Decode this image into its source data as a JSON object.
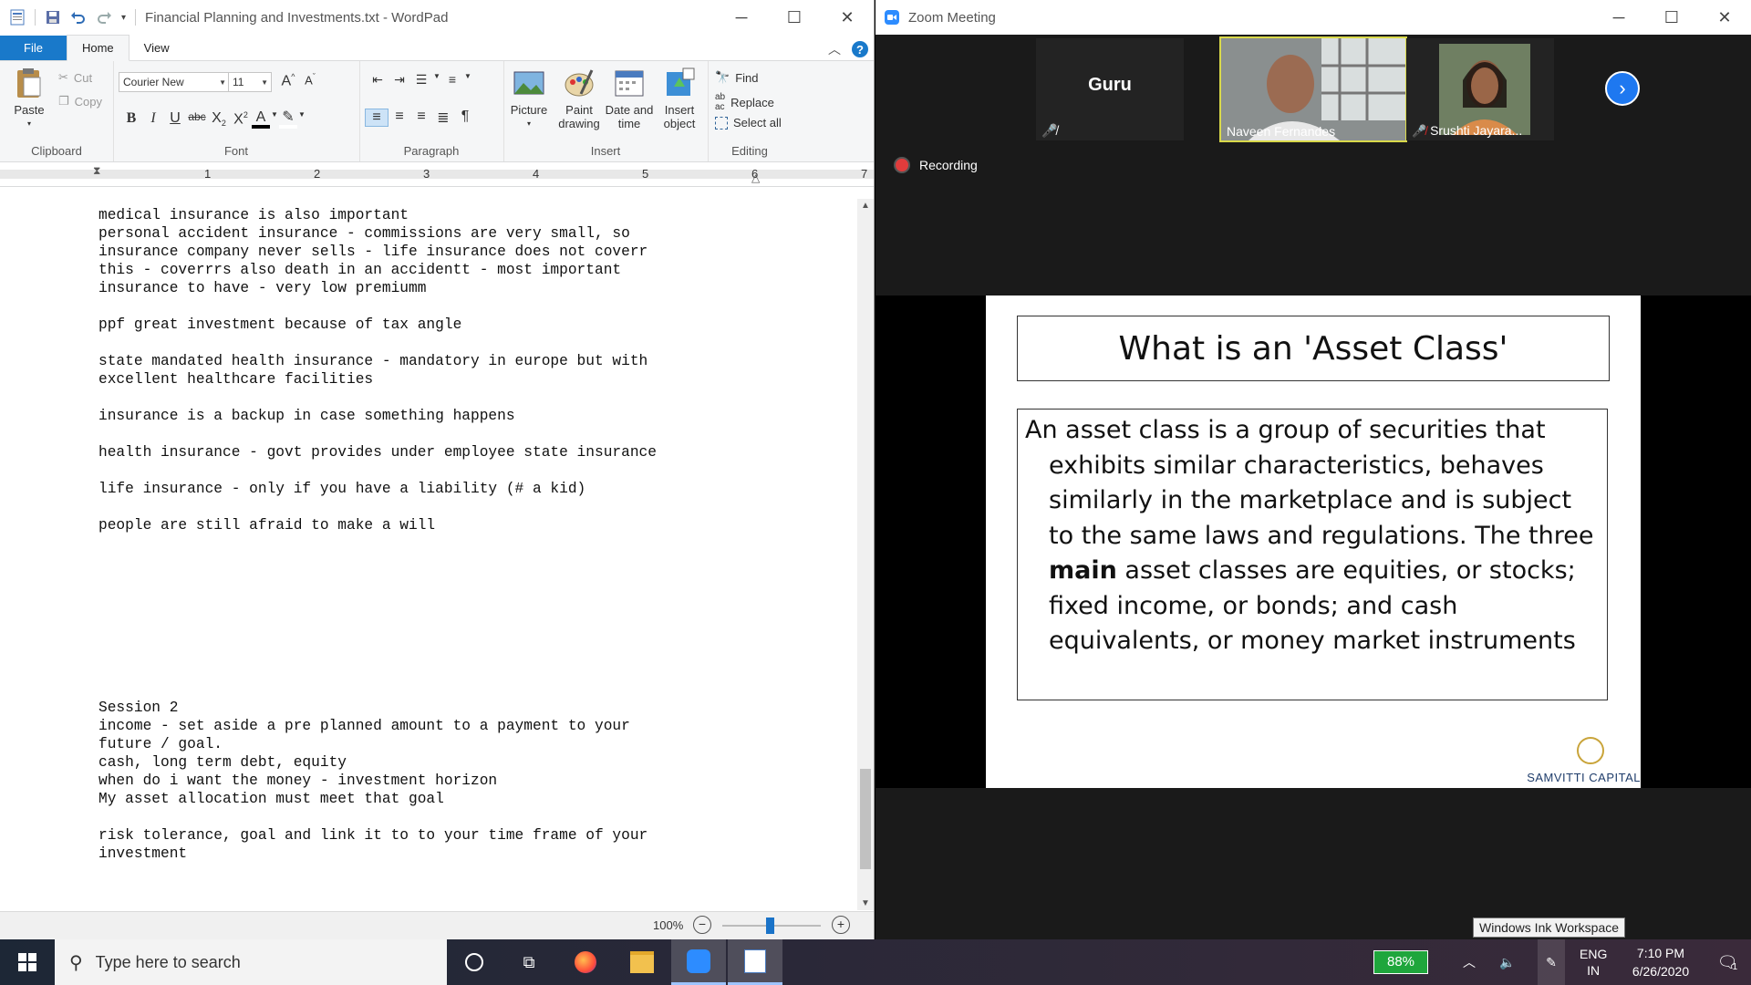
{
  "wordpad": {
    "title": "Financial Planning and Investments.txt - WordPad",
    "tabs": {
      "file": "File",
      "home": "Home",
      "view": "View"
    },
    "clipboard": {
      "paste": "Paste",
      "cut": "Cut",
      "copy": "Copy",
      "label": "Clipboard"
    },
    "font": {
      "family": "Courier New",
      "size": "11",
      "label": "Font"
    },
    "paragraph": {
      "label": "Paragraph"
    },
    "insert": {
      "picture": "Picture",
      "paint_line1": "Paint",
      "paint_line2": "drawing",
      "date_line1": "Date and",
      "date_line2": "time",
      "object_line1": "Insert",
      "object_line2": "object",
      "label": "Insert"
    },
    "editing": {
      "find": "Find",
      "replace": "Replace",
      "select_all": "Select all",
      "label": "Editing"
    },
    "ruler_numbers": [
      "1",
      "2",
      "3",
      "4",
      "5",
      "6",
      "7"
    ],
    "document_text": "medical insurance is also important\npersonal accident insurance - commissions are very small, so\ninsurance company never sells - life insurance does not coverr\nthis - coverrrs also death in an accidentt - most important\ninsurance to have - very low premiumm\n\nppf great investment because of tax angle\n\nstate mandated health insurance - mandatory in europe but with\nexcellent healthcare facilities\n\ninsurance is a backup in case something happens\n\nhealth insurance - govt provides under employee state insurance\n\nlife insurance - only if you have a liability (# a kid)\n\npeople are still afraid to make a will\n\n\n\n\n\n\n\n\n\nSession 2\nincome - set aside a pre planned amount to a payment to your\nfuture / goal.\ncash, long term debt, equity\nwhen do i want the money - investment horizon\nMy asset allocation must meet that goal\n\nrisk tolerance, goal and link it to to your time frame of your\ninvestment",
    "zoom_level": "100%"
  },
  "zoom": {
    "title": "Zoom Meeting",
    "participants": [
      {
        "name": "Guru",
        "muted": true
      },
      {
        "name": "Naveen Fernandes",
        "muted": false
      },
      {
        "name": "Srushti Jayara...",
        "muted": true
      }
    ],
    "recording_label": "Recording",
    "slide": {
      "title": "What is an 'Asset Class'",
      "body_before": "An asset class is a group of securities that exhibits similar characteristics, behaves similarly in the marketplace and is subject to the same laws and regulations. The three ",
      "body_bold": "main",
      "body_after": " asset classes are equities, or stocks; fixed income, or bonds; and cash equivalents, or money market instruments",
      "brand": "SAMVITTI CAPITAL"
    }
  },
  "tooltip": "Windows Ink Workspace",
  "taskbar": {
    "search_placeholder": "Type here to search",
    "battery": "88%",
    "lang_line1": "ENG",
    "lang_line2": "IN",
    "time": "7:10 PM",
    "date": "6/26/2020",
    "notifications": "1"
  }
}
